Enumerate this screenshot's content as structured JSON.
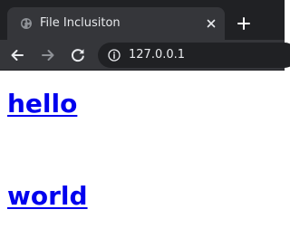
{
  "browser": {
    "tab": {
      "title": "File Inclusiton",
      "favicon": "globe-icon"
    },
    "new_tab_icon": "plus-icon",
    "close_tab_icon": "close-icon",
    "toolbar": {
      "back_icon": "arrow-left-icon",
      "forward_icon": "arrow-right-icon",
      "reload_icon": "reload-icon",
      "site_info_icon": "info-icon",
      "url": "127.0.0.1"
    },
    "colors": {
      "chrome_dark": "#202124",
      "chrome_tab": "#35363a",
      "chrome_text": "#e8eaed",
      "link": "#0000ee"
    }
  },
  "page": {
    "links": [
      {
        "label": "hello"
      },
      {
        "label": "world"
      }
    ]
  }
}
